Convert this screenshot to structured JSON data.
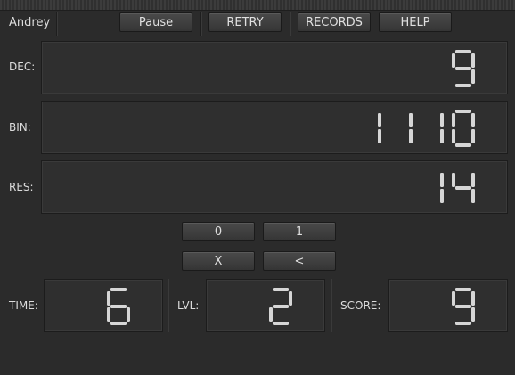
{
  "player": {
    "name": "Andrey"
  },
  "toolbar": {
    "pause_label": "Pause",
    "retry_label": "RETRY",
    "records_label": "RECORDS",
    "help_label": "HELP"
  },
  "rows": {
    "dec": {
      "label": "DEC:",
      "value": "9"
    },
    "bin": {
      "label": "BIN:",
      "value": "1110"
    },
    "res": {
      "label": "RES:",
      "value": "14"
    }
  },
  "keypad": {
    "zero_label": "0",
    "one_label": "1",
    "clear_label": "X",
    "back_label": "<"
  },
  "stats": {
    "time": {
      "label": "TIME:",
      "value": "6"
    },
    "level": {
      "label": "LVL:",
      "value": "2"
    },
    "score": {
      "label": "SCORE:",
      "value": "9"
    }
  },
  "colors": {
    "segment": "#d6d6d6",
    "background": "#2b2b2b"
  }
}
